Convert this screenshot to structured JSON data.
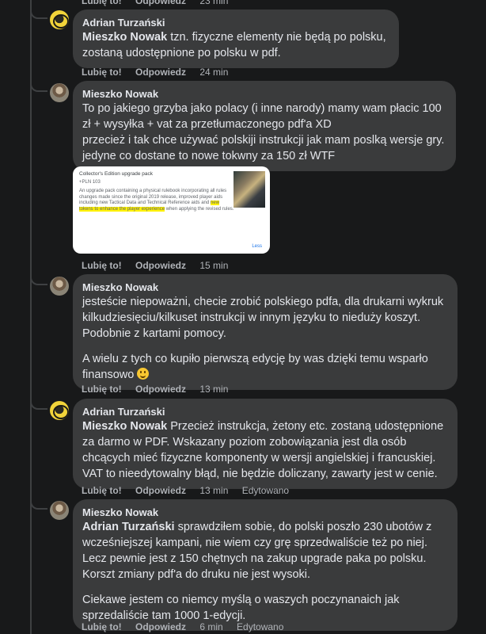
{
  "top_actions": {
    "like": "Lubię to!",
    "reply": "Odpowiedz",
    "time": "23 min"
  },
  "comments": [
    {
      "author": "Adrian Turzański",
      "mention": "Mieszko Nowak",
      "text": " tzn. fizyczne elementy nie będą po polsku, zostaną udostępnione po polsku w pdf.",
      "like": "Lubię to!",
      "reply": "Odpowiedz",
      "time": "24 min"
    },
    {
      "author": "Mieszko Nowak",
      "text": "To po jakiego grzyba jako polacy (i inne narody) mamy wam płacic 100 zł + wysyłka + vat za przetłumaczonego pdf'a XD\nprzecież i tak chce używać polskiji instrukcji jak mam poslką wersje gry.\njedyne co dostane to nowe tokwny za 150 zł WTF",
      "attachment": {
        "title": "Collector's Edition upgrade pack",
        "subtitle": "+PLN 103",
        "body_before": "An upgrade pack containing a physical rulebook incorporating all rules changes made since the original 2019 release, improved player aids including new Tactical Data and Technical Reference aids and ",
        "highlight": "new tokens to enhance the player experience",
        "body_after": " when applying the revised rules.",
        "more": "Less"
      },
      "like": "Lubię to!",
      "reply": "Odpowiedz",
      "time": "15 min"
    },
    {
      "author": "Mieszko Nowak",
      "paragraph1": "jesteście niepoważni, checie zrobić polskiego pdfa, dla drukarni wykruk kilkudziesięciu/kilkuset instrukcji w innym języku to niedużу koszyt. Podobnie z kartami pomocy.",
      "paragraph2": "A wielu z tych co kupiło pierwszą edycję by was dzięki temu wsparło finansowo",
      "emoji": "slightly-smiling-face",
      "like": "Lubię to!",
      "reply": "Odpowiedz",
      "time": "13 min"
    },
    {
      "author": "Adrian Turzański",
      "mention": "Mieszko Nowak",
      "text": " Przecież instrukcja, żetony etc. zostaną udostępnione za darmo w PDF. Wskazany poziom zobowiązania jest dla osób chcących mieć fizyczne komponenty w wersji angielskiej i francuskiej. VAT to nieedytowalny błąd, nie będzie doliczany, zawarty jest w cenie.",
      "like": "Lubię to!",
      "reply": "Odpowiedz",
      "time": "13 min",
      "edited": "Edytowano"
    },
    {
      "author": "Mieszko Nowak",
      "mention": "Adrian Turzański",
      "text": " sprawdziłem sobie, do polski poszło 230 ubotów z wcześniejszej kampani, nie wiem czy grę sprzedwaliście też po niej. Lecz pewnie jest z 150 chętnych na zakup upgrade paka po polsku. Korszt zmiany pdf'a do druku nie jest wysoki.",
      "paragraph2": "Ciekawe jestem co niemcy myślą o waszych poczynanaich jak sprzedaliście tam 1000 1-edycji.",
      "like": "Lubię to!",
      "reply": "Odpowiedz",
      "time": "6 min",
      "edited": "Edytowano"
    }
  ]
}
